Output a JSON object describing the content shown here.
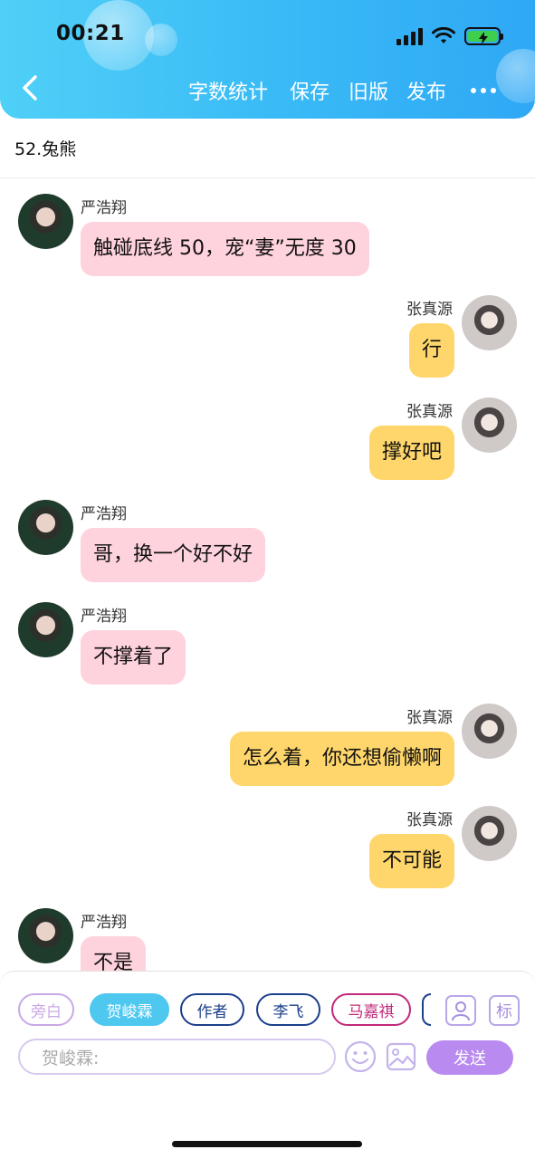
{
  "status_bar": {
    "time": "00:21"
  },
  "top_menu": [
    {
      "label": "字数统计"
    },
    {
      "label": "保存"
    },
    {
      "label": "旧版"
    },
    {
      "label": "发布"
    }
  ],
  "chapter": {
    "title": "52.兔熊"
  },
  "messages": [
    {
      "side": "left",
      "sender": "严浩翔",
      "text": "触碰底线 50，宠“妻”无度 30"
    },
    {
      "side": "right",
      "sender": "张真源",
      "text": "行"
    },
    {
      "side": "right",
      "sender": "张真源",
      "text": "撑好吧"
    },
    {
      "side": "left",
      "sender": "严浩翔",
      "text": "哥，换一个好不好"
    },
    {
      "side": "left",
      "sender": "严浩翔",
      "text": "不撑着了"
    },
    {
      "side": "right",
      "sender": "张真源",
      "text": "怎么着，你还想偷懒啊"
    },
    {
      "side": "right",
      "sender": "张真源",
      "text": "不可能"
    },
    {
      "side": "left",
      "sender": "严浩翔",
      "text": "不是"
    }
  ],
  "role_chips": [
    {
      "label": "旁白",
      "color": "#c9a8e6",
      "active": false
    },
    {
      "label": "贺峻霖",
      "color": "#4fc8f0",
      "active": true
    },
    {
      "label": "作者",
      "color": "#1b3f8a",
      "active": false
    },
    {
      "label": "李飞",
      "color": "#1b3f8a",
      "active": false
    },
    {
      "label": "马嘉祺",
      "color": "#c2287a",
      "active": false
    }
  ],
  "toolbar": {
    "mark_label": "标",
    "input_placeholder": "贺峻霖:",
    "send_label": "发送"
  },
  "colors": {
    "header_gradient_start": "#4fd0f7",
    "header_gradient_end": "#2fa8f5",
    "left_bubble": "#ffd3dd",
    "right_bubble": "#ffd66b",
    "send_button": "#b98af0"
  }
}
